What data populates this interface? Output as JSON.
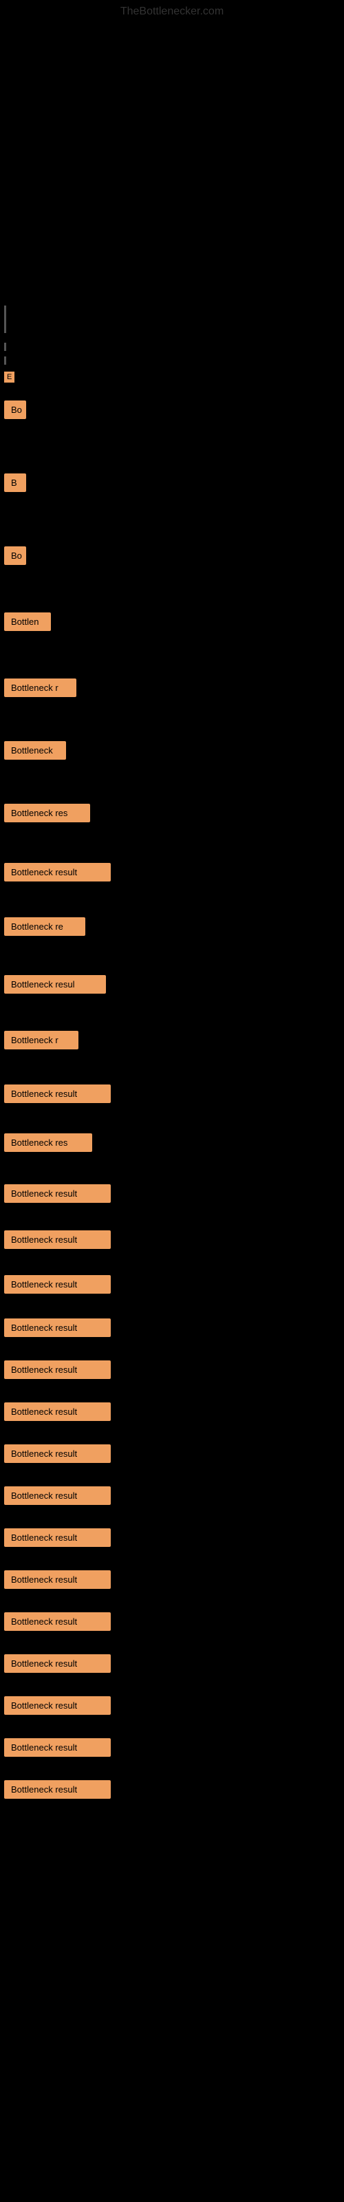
{
  "site": {
    "title": "TheBottlenecker.com"
  },
  "items": [
    {
      "id": 1,
      "label": "B",
      "width": "w-30"
    },
    {
      "id": 2,
      "label": "B",
      "width": "w-30"
    },
    {
      "id": 3,
      "label": "B",
      "width": "w-30"
    },
    {
      "id": 4,
      "label": "Bottlen",
      "width": "w-70"
    },
    {
      "id": 5,
      "label": "Bottleneck r",
      "width": "w-110"
    },
    {
      "id": 6,
      "label": "Bottleneck",
      "width": "w-90"
    },
    {
      "id": 7,
      "label": "Bottleneck res",
      "width": "w-130"
    },
    {
      "id": 8,
      "label": "Bottleneck result",
      "width": "w-160"
    },
    {
      "id": 9,
      "label": "Bottleneck re",
      "width": "w-120"
    },
    {
      "id": 10,
      "label": "Bottleneck resul",
      "width": "w-150"
    },
    {
      "id": 11,
      "label": "Bottleneck r",
      "width": "w-110"
    },
    {
      "id": 12,
      "label": "Bottleneck result",
      "width": "w-160"
    },
    {
      "id": 13,
      "label": "Bottleneck res",
      "width": "w-130"
    },
    {
      "id": 14,
      "label": "Bottleneck result",
      "width": "w-160"
    },
    {
      "id": 15,
      "label": "Bottleneck result",
      "width": "w-160"
    },
    {
      "id": 16,
      "label": "Bottleneck result",
      "width": "w-160"
    },
    {
      "id": 17,
      "label": "Bottleneck result",
      "width": "w-160"
    },
    {
      "id": 18,
      "label": "Bottleneck result",
      "width": "w-160"
    },
    {
      "id": 19,
      "label": "Bottleneck result",
      "width": "w-160"
    },
    {
      "id": 20,
      "label": "Bottleneck result",
      "width": "w-160"
    },
    {
      "id": 21,
      "label": "Bottleneck result",
      "width": "w-160"
    },
    {
      "id": 22,
      "label": "Bottleneck result",
      "width": "w-160"
    },
    {
      "id": 23,
      "label": "Bottleneck result",
      "width": "w-160"
    },
    {
      "id": 24,
      "label": "Bottleneck result",
      "width": "w-160"
    },
    {
      "id": 25,
      "label": "Bottleneck result",
      "width": "w-160"
    },
    {
      "id": 26,
      "label": "Bottleneck result",
      "width": "w-160"
    },
    {
      "id": 27,
      "label": "Bottleneck result",
      "width": "w-160"
    },
    {
      "id": 28,
      "label": "Bottleneck result",
      "width": "w-160"
    }
  ]
}
